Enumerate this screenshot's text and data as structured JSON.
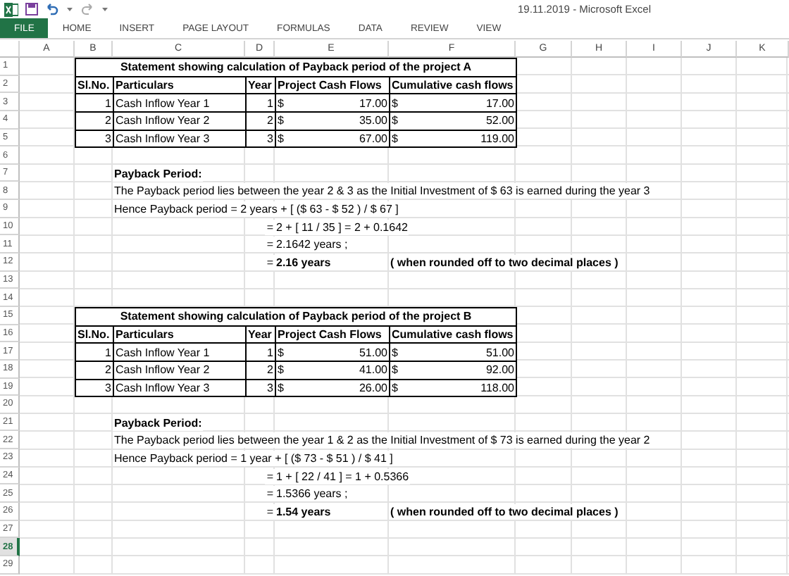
{
  "window": {
    "title": "19.11.2019 - Microsoft Excel"
  },
  "ribbon_tabs": [
    {
      "label": "FILE",
      "selected": true
    },
    {
      "label": "HOME",
      "selected": false
    },
    {
      "label": "INSERT",
      "selected": false
    },
    {
      "label": "PAGE LAYOUT",
      "selected": false
    },
    {
      "label": "FORMULAS",
      "selected": false
    },
    {
      "label": "DATA",
      "selected": false
    },
    {
      "label": "REVIEW",
      "selected": false
    },
    {
      "label": "VIEW",
      "selected": false
    }
  ],
  "columns": [
    "A",
    "B",
    "C",
    "D",
    "E",
    "F",
    "G",
    "H",
    "I",
    "J",
    "K"
  ],
  "rows": [
    {
      "label": "1",
      "selected": false
    },
    {
      "label": "2",
      "selected": false
    },
    {
      "label": "3",
      "selected": false
    },
    {
      "label": "4",
      "selected": false
    },
    {
      "label": "5",
      "selected": false
    },
    {
      "label": "6",
      "selected": false
    },
    {
      "label": "7",
      "selected": false
    },
    {
      "label": "8",
      "selected": false
    },
    {
      "label": "9",
      "selected": false
    },
    {
      "label": "10",
      "selected": false
    },
    {
      "label": "11",
      "selected": false
    },
    {
      "label": "12",
      "selected": false
    },
    {
      "label": "13",
      "selected": false
    },
    {
      "label": "14",
      "selected": false
    },
    {
      "label": "15",
      "selected": false
    },
    {
      "label": "16",
      "selected": false
    },
    {
      "label": "17",
      "selected": false
    },
    {
      "label": "18",
      "selected": false
    },
    {
      "label": "19",
      "selected": false
    },
    {
      "label": "20",
      "selected": false
    },
    {
      "label": "21",
      "selected": false
    },
    {
      "label": "22",
      "selected": false
    },
    {
      "label": "23",
      "selected": false
    },
    {
      "label": "24",
      "selected": false
    },
    {
      "label": "25",
      "selected": false
    },
    {
      "label": "26",
      "selected": false
    },
    {
      "label": "27",
      "selected": false
    },
    {
      "label": "28",
      "selected": true
    },
    {
      "label": "29",
      "selected": false
    }
  ],
  "projects": [
    {
      "title": "Statement showing calculation of Payback period of the project A",
      "headers": [
        "Sl.No.",
        "Particulars",
        "Year",
        "Project Cash Flows",
        "Cumulative cash flows"
      ],
      "rows": [
        {
          "sl": "1",
          "particulars": "Cash Inflow Year 1",
          "year": "1",
          "cash_flow": {
            "currency": "$",
            "amount": "17.00"
          },
          "cumulative": {
            "currency": "$",
            "amount": "17.00"
          }
        },
        {
          "sl": "2",
          "particulars": "Cash Inflow Year 2",
          "year": "2",
          "cash_flow": {
            "currency": "$",
            "amount": "35.00"
          },
          "cumulative": {
            "currency": "$",
            "amount": "52.00"
          }
        },
        {
          "sl": "3",
          "particulars": "Cash Inflow Year 3",
          "year": "3",
          "cash_flow": {
            "currency": "$",
            "amount": "67.00"
          },
          "cumulative": {
            "currency": "$",
            "amount": "119.00"
          }
        }
      ],
      "payback": {
        "heading": "Payback Period:",
        "sentence": "The Payback period lies between the year 2 & 3 as the Initial Investment of $ 63 is earned during the year 3",
        "formula": "Hence Payback period  = 2 years + [ ($ 63 - $ 52 ) / $ 67 ]",
        "steps": [
          {
            "eq": "=",
            "value": "2 + [ 11 / 35 ] = 2 + 0.1642",
            "bold": false
          },
          {
            "eq": "=",
            "value": "2.1642 years ;",
            "bold": false
          },
          {
            "eq": "=",
            "value": "2.16 years",
            "bold": true,
            "note": "( when rounded off to two decimal places )"
          }
        ]
      }
    },
    {
      "title": "Statement showing calculation of Payback period of the project B",
      "headers": [
        "Sl.No.",
        "Particulars",
        "Year",
        "Project Cash Flows",
        "Cumulative cash flows"
      ],
      "rows": [
        {
          "sl": "1",
          "particulars": "Cash Inflow Year 1",
          "year": "1",
          "cash_flow": {
            "currency": "$",
            "amount": "51.00"
          },
          "cumulative": {
            "currency": "$",
            "amount": "51.00"
          }
        },
        {
          "sl": "2",
          "particulars": "Cash Inflow Year 2",
          "year": "2",
          "cash_flow": {
            "currency": "$",
            "amount": "41.00"
          },
          "cumulative": {
            "currency": "$",
            "amount": "92.00"
          }
        },
        {
          "sl": "3",
          "particulars": "Cash Inflow Year 3",
          "year": "3",
          "cash_flow": {
            "currency": "$",
            "amount": "26.00"
          },
          "cumulative": {
            "currency": "$",
            "amount": "118.00"
          }
        }
      ],
      "payback": {
        "heading": "Payback Period:",
        "sentence": "The Payback period lies between the year 1 & 2 as the Initial Investment of $ 73 is earned during the year 2",
        "formula": "Hence Payback period  = 1 year + [ ($ 73 - $ 51 ) / $ 41 ]",
        "steps": [
          {
            "eq": "=",
            "value": "1 + [ 22 / 41 ] = 1 + 0.5366",
            "bold": false
          },
          {
            "eq": "=",
            "value": "1.5366 years ;",
            "bold": false
          },
          {
            "eq": "=",
            "value": "1.54 years",
            "bold": true,
            "note": "( when rounded off to two decimal places )"
          }
        ]
      }
    }
  ]
}
